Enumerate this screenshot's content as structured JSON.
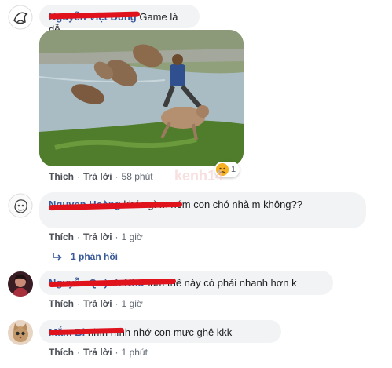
{
  "actions": {
    "like": "Thích",
    "reply": "Trả lời",
    "dot": "·"
  },
  "comments": [
    {
      "name": "Nguyễn Việt Dũng",
      "text": "Game là dễ",
      "time": "58 phút",
      "image": {
        "icon": "photo-dogs-in-river",
        "watermark": "kenh14"
      },
      "reaction": {
        "icon": "sad-icon",
        "count": "1"
      }
    },
    {
      "name": "Nguyen Hoàng",
      "text": "khác gì m ném con chó nhà m không??",
      "time": "1 giờ",
      "replies": "1 phản hồi"
    },
    {
      "name": "Nguyễn Quỳnh Như",
      "text": "làm thế này có phải nhanh hơn k",
      "time": "1 giờ"
    },
    {
      "name": "Mắm Bi",
      "text": "nhìn hình nhớ con mực ghê kkk",
      "time": "1 phút"
    }
  ],
  "colors": {
    "redaction": "#e0121b",
    "name": "#385898",
    "bubble": "#f2f3f5"
  }
}
